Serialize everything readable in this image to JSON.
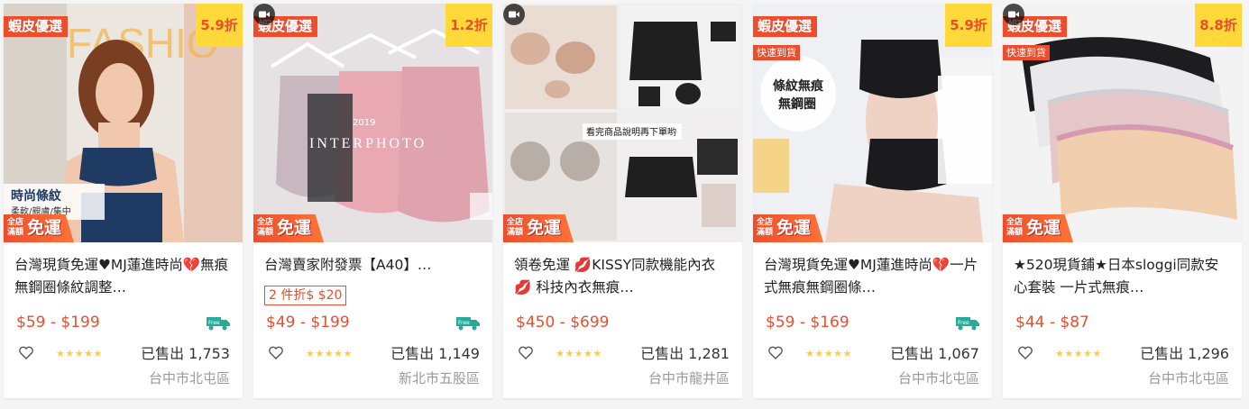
{
  "colors": {
    "accent": "#ee4d2d",
    "discount_bg": "#ffd839",
    "star": "#ffce3d",
    "free_ship_green": "#26aa99"
  },
  "icons": {
    "wishlist": "heart-outline-icon",
    "shipping": "free-shipping-truck-icon",
    "video": "video-camera-icon",
    "rating": "star-icon"
  },
  "products": [
    {
      "tag": "蝦皮優選",
      "discount": "5.9折",
      "fast": "",
      "free_small": "全店滿額",
      "free_big": "免運",
      "image_text": "時尚條紋",
      "image_text2": "柔軟/親膚/集中",
      "title": "台灣現貨免運♥MJ蓮進時尚💔無痕無鋼圈條紋調整…",
      "promo": "",
      "price": "$59 - $199",
      "free_label": "Free",
      "rating": "★★★★★",
      "sold": "已售出 1,753",
      "location": "台中市北屯區"
    },
    {
      "tag": "蝦皮優選",
      "discount": "1.2折",
      "fast": "",
      "free_small": "全店滿額",
      "free_big": "免運",
      "image_text": "2019",
      "image_text2": "INTERPHOTO",
      "title": "台灣賣家附發票【A40】…",
      "promo": "2 件折$ $20",
      "price": "$49 - $199",
      "free_label": "Free",
      "rating": "★★★★★",
      "sold": "已售出 1,149",
      "location": "新北市五股區"
    },
    {
      "tag": "",
      "discount": "",
      "fast": "",
      "free_small": "全店滿額",
      "free_big": "免運",
      "image_text": "看完商品說明再下單哟",
      "image_text2": "",
      "title": "領卷免運 💋KISSY同款機能內衣💋 科技內衣無痕…",
      "promo": "",
      "price": "$450 - $699",
      "free_label": "",
      "rating": "★★★★★",
      "sold": "已售出 1,281",
      "location": "台中市龍井區"
    },
    {
      "tag": "蝦皮優選",
      "discount": "5.9折",
      "fast": "快速到貨",
      "free_small": "全店滿額",
      "free_big": "免運",
      "image_text": "條紋無痕",
      "image_text2": "無鋼圈",
      "title": "台灣現貨免運♥MJ蓮進時尚💔一片式無痕無鋼圈條…",
      "promo": "",
      "price": "$59 - $169",
      "free_label": "Free",
      "rating": "★★★★★",
      "sold": "已售出 1,067",
      "location": "台中市北屯區"
    },
    {
      "tag": "蝦皮優選",
      "discount": "8.8折",
      "fast": "快速到貨",
      "free_small": "全店滿額",
      "free_big": "免運",
      "image_text": "",
      "image_text2": "",
      "title": "★520現貨鋪★日本sloggi同款安心套裝 一片式無痕…",
      "promo": "",
      "price": "$44 - $87",
      "free_label": "",
      "rating": "★★★★★",
      "sold": "已售出 1,296",
      "location": "台中市北屯區"
    }
  ]
}
